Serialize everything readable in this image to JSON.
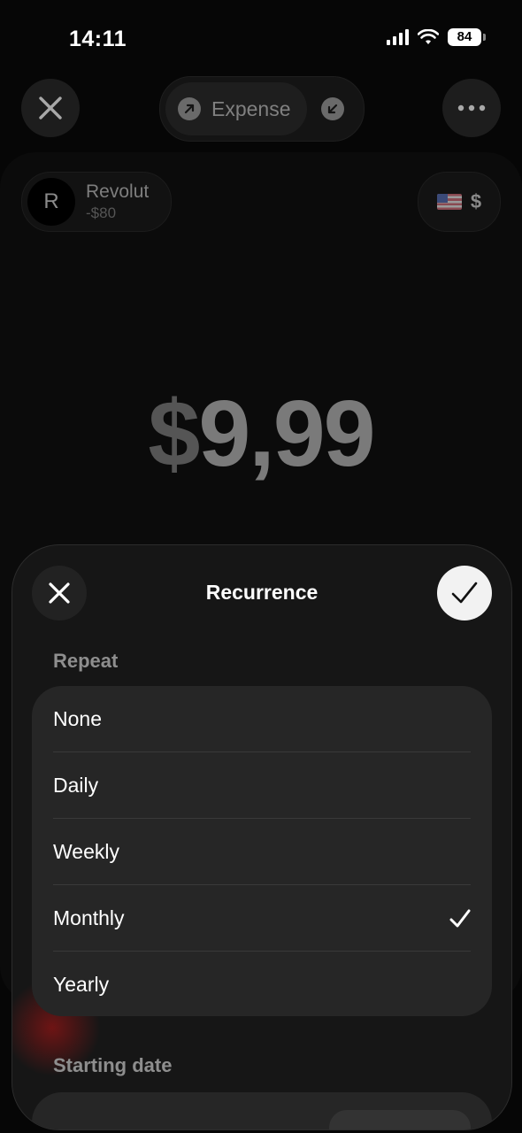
{
  "status_bar": {
    "time": "14:11",
    "battery": "84"
  },
  "nav": {
    "type_label": "Expense"
  },
  "account": {
    "avatar_letter": "R",
    "name": "Revolut",
    "balance": "-$80"
  },
  "currency": {
    "symbol": "$"
  },
  "amount": {
    "currency": "$",
    "value": "9,99"
  },
  "sheet": {
    "title": "Recurrence",
    "repeat_label": "Repeat",
    "options": [
      {
        "label": "None",
        "selected": false
      },
      {
        "label": "Daily",
        "selected": false
      },
      {
        "label": "Weekly",
        "selected": false
      },
      {
        "label": "Monthly",
        "selected": true
      },
      {
        "label": "Yearly",
        "selected": false
      }
    ],
    "starting_date_label": "Starting date"
  }
}
